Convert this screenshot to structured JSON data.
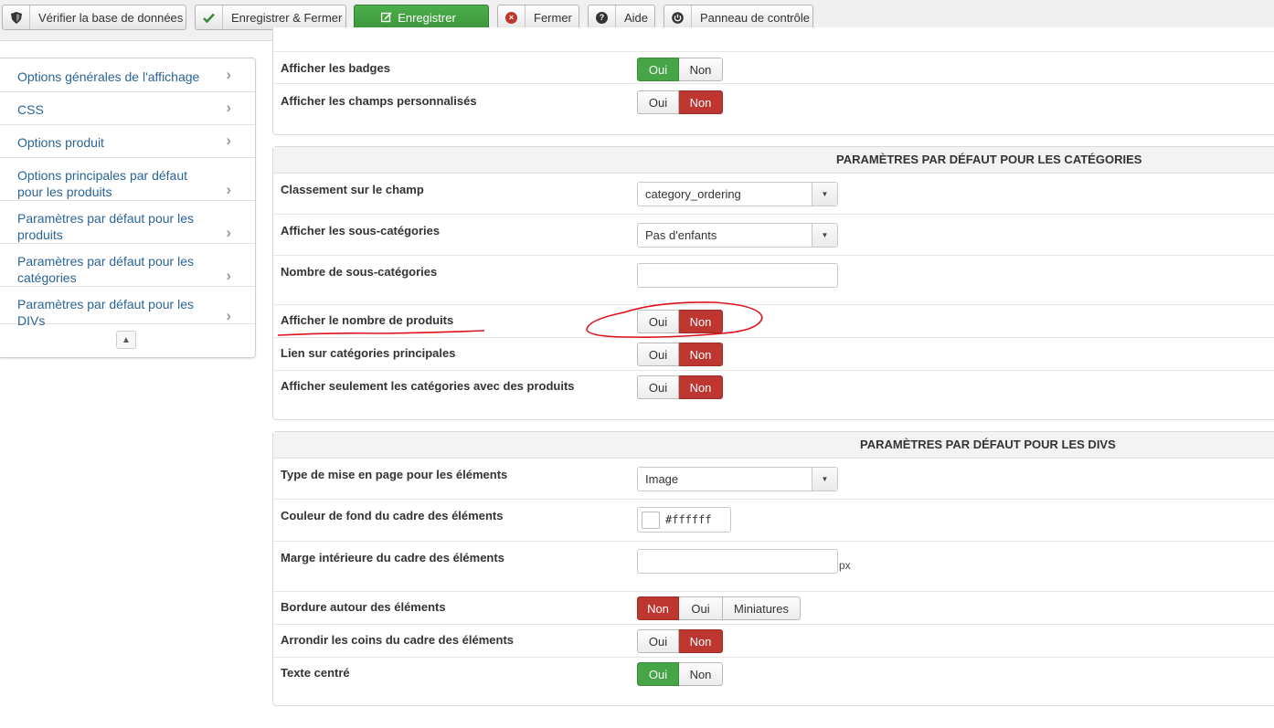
{
  "toolbar": {
    "check_db": "Vérifier la base de données",
    "save_close": "Enregistrer & Fermer",
    "save": "Enregistrer",
    "close": "Fermer",
    "help": "Aide",
    "control_panel": "Panneau de contrôle"
  },
  "sidebar": {
    "items": [
      {
        "label": "Options générales de l'affichage"
      },
      {
        "label": "CSS"
      },
      {
        "label": "Options produit"
      },
      {
        "label": "Options principales par défaut pour les produits"
      },
      {
        "label": "Paramètres par défaut pour les produits"
      },
      {
        "label": "Paramètres par défaut pour les catégories"
      },
      {
        "label": "Paramètres par défaut pour les DIVs"
      }
    ]
  },
  "panel1": {
    "rows": [
      {
        "label": "Afficher les badges",
        "selected": "Oui"
      },
      {
        "label": "Afficher les champs personnalisés",
        "selected": "Non"
      }
    ]
  },
  "categories": {
    "title": "PARAMÈTRES PAR DÉFAUT POUR LES CATÉGORIES",
    "ordering": {
      "label": "Classement sur le champ",
      "value": "category_ordering"
    },
    "subcats": {
      "label": "Afficher les sous-catégories",
      "value": "Pas d'enfants"
    },
    "subcats_number": {
      "label": "Nombre de sous-catégories",
      "value": ""
    },
    "show_count": {
      "label": "Afficher le nombre de produits",
      "selected": "Non"
    },
    "main_link": {
      "label": "Lien sur catégories principales",
      "selected": "Non"
    },
    "only_with_products": {
      "label": "Afficher seulement les catégories avec des produits",
      "selected": "Non"
    }
  },
  "divs": {
    "title": "PARAMÈTRES PAR DÉFAUT POUR LES DIVS",
    "layout_type": {
      "label": "Type de mise en page pour les éléments",
      "value": "Image"
    },
    "bg_color": {
      "label": "Couleur de fond du cadre des éléments",
      "value": "#ffffff"
    },
    "padding": {
      "label": "Marge intérieure du cadre des éléments",
      "value": "",
      "unit": "px"
    },
    "border": {
      "label": "Bordure autour des éléments",
      "options": [
        "Non",
        "Oui",
        "Miniatures"
      ],
      "selected": "Non"
    },
    "rounded": {
      "label": "Arrondir les coins du cadre des éléments",
      "selected": "Non"
    },
    "centered": {
      "label": "Texte centré",
      "selected": "Oui"
    }
  },
  "toggle": {
    "yes": "Oui",
    "no": "Non"
  },
  "colors": {
    "green": "#46a546",
    "red": "#bd362f",
    "link": "#2a6496",
    "annotation": "#e0101a"
  },
  "icons": {
    "check_db": "shield-icon",
    "save_close": "check-icon",
    "save": "edit-icon",
    "close": "cancel-icon",
    "help": "question-icon",
    "control_panel": "power-icon"
  }
}
